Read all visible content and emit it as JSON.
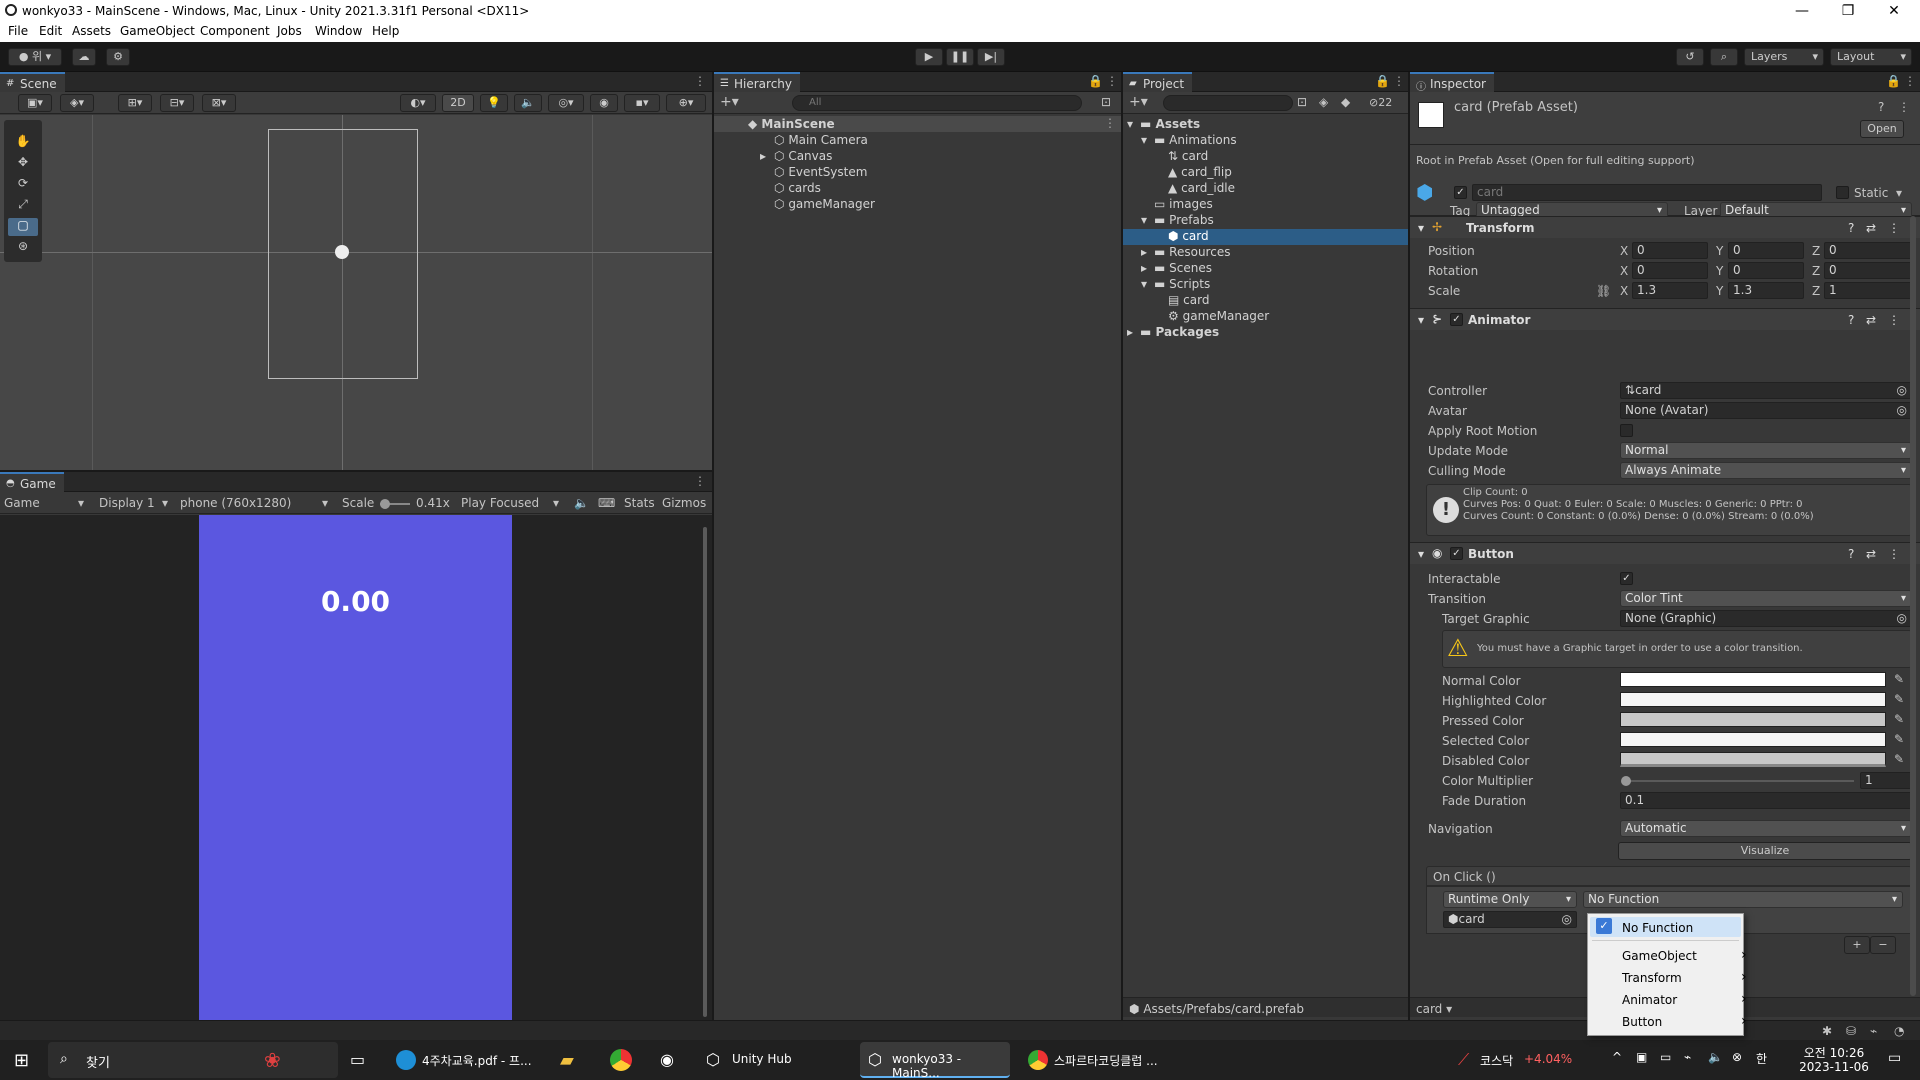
{
  "window": {
    "title": "wonkyo33 - MainScene - Windows, Mac, Linux - Unity 2021.3.31f1 Personal <DX11>"
  },
  "menu": [
    "File",
    "Edit",
    "Assets",
    "GameObject",
    "Component",
    "Jobs",
    "Window",
    "Help"
  ],
  "toolbar": {
    "account": "위",
    "layers": "Layers",
    "layout": "Layout"
  },
  "scene": {
    "tab": "Scene",
    "two_d": "2D"
  },
  "game": {
    "tab": "Game",
    "view": "Game",
    "display": "Display 1",
    "resolution": "phone (760x1280)",
    "scale_label": "Scale",
    "scale_value": "0.41x",
    "play_mode": "Play Focused",
    "stats": "Stats",
    "gizmos": "Gizmos",
    "timer": "0.00",
    "bg_color": "#5b57e0"
  },
  "hierarchy": {
    "tab": "Hierarchy",
    "search_placeholder": "All",
    "scene": "MainScene",
    "items": [
      "Main Camera",
      "Canvas",
      "EventSystem",
      "cards",
      "gameManager"
    ]
  },
  "project": {
    "tab": "Project",
    "hidden_count": "22",
    "items": [
      "Assets",
      "Animations",
      "card",
      "card_flip",
      "card_idle",
      "images",
      "Prefabs",
      "card",
      "Resources",
      "Scenes",
      "Scripts",
      "card",
      "gameManager",
      "Packages"
    ],
    "path": "Assets/Prefabs/card.prefab"
  },
  "inspector": {
    "tab": "Inspector",
    "asset_title": "card (Prefab Asset)",
    "open": "Open",
    "root_note": "Root in Prefab Asset (Open for full editing support)",
    "name": "card",
    "static": "Static",
    "tag_label": "Tag",
    "tag": "Untagged",
    "layer_label": "Layer",
    "layer": "Default",
    "transform": {
      "title": "Transform",
      "position": "Position",
      "rotation": "Rotation",
      "scale": "Scale",
      "pos": [
        "0",
        "0",
        "0"
      ],
      "rot": [
        "0",
        "0",
        "0"
      ],
      "scl": [
        "1.3",
        "1.3",
        "1"
      ],
      "axes": [
        "X",
        "Y",
        "Z"
      ]
    },
    "animator": {
      "title": "Animator",
      "controller_label": "Controller",
      "controller": "card",
      "avatar_label": "Avatar",
      "avatar": "None (Avatar)",
      "root_motion": "Apply Root Motion",
      "update_label": "Update Mode",
      "update": "Normal",
      "culling_label": "Culling Mode",
      "culling": "Always Animate",
      "info1": "Clip Count: 0",
      "info2": "Curves Pos: 0 Quat: 0 Euler: 0 Scale: 0 Muscles: 0 Generic: 0 PPtr: 0",
      "info3": "Curves Count: 0 Constant: 0 (0.0%) Dense: 0 (0.0%) Stream: 0 (0.0%)"
    },
    "button": {
      "title": "Button",
      "interactable": "Interactable",
      "transition_label": "Transition",
      "transition": "Color Tint",
      "target_label": "Target Graphic",
      "target": "None (Graphic)",
      "warning": "You must have a Graphic target in order to use a color transition.",
      "normal": "Normal Color",
      "highlighted": "Highlighted Color",
      "pressed": "Pressed Color",
      "selected": "Selected Color",
      "disabled": "Disabled Color",
      "multiplier": "Color Multiplier",
      "multiplier_value": "1",
      "fade": "Fade Duration",
      "fade_value": "0.1",
      "navigation_label": "Navigation",
      "navigation": "Automatic",
      "visualize": "Visualize",
      "onclick": "On Click ()",
      "runtime": "Runtime Only",
      "function": "No Function",
      "object": "card",
      "plus": "+",
      "minus": "−"
    },
    "footer": "card"
  },
  "popup": {
    "items": [
      "No Function",
      "GameObject",
      "Transform",
      "Animator",
      "Button"
    ]
  },
  "taskbar": {
    "search": "찾기",
    "apps": [
      "4주차교육.pdf - 프...",
      "Unity Hub",
      "wonkyo33 - MainS...",
      "스파르타코딩클럽 ..."
    ],
    "stock": "코스닥",
    "stock_change": "+4.04%",
    "time": "오전 10:26",
    "date": "2023-11-06"
  }
}
